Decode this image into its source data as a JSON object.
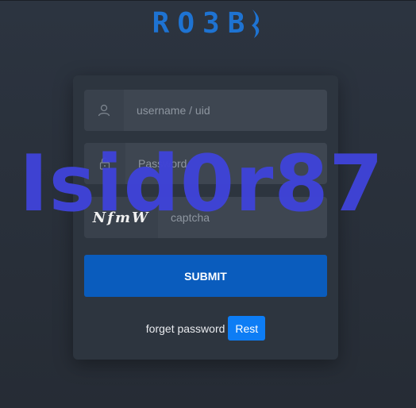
{
  "brand": {
    "logo_text": "RO3B",
    "color": "#1e73d2"
  },
  "login": {
    "username": {
      "placeholder": "username / uid",
      "icon": "user-icon"
    },
    "password": {
      "placeholder": "Password",
      "icon": "lock-icon"
    },
    "captcha": {
      "image_text": "NfmW",
      "placeholder": "captcha"
    },
    "submit_label": "SUBMIT",
    "forget_label": "forget password",
    "rest_label": "Rest"
  },
  "watermark": {
    "text": "Isid0r87",
    "color": "#3f43d6"
  },
  "colors": {
    "background": "#2a313b",
    "card": "#2d353f",
    "submit": "#0a5cbd",
    "rest": "#0d7df5"
  }
}
